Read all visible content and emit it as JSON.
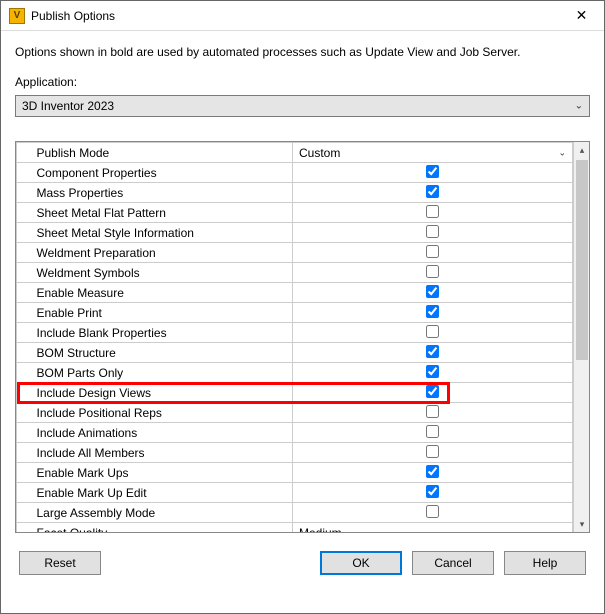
{
  "window": {
    "title": "Publish Options",
    "icon_letter": "V"
  },
  "description": "Options shown in bold are used by automated processes such as Update View and Job Server.",
  "application_label": "Application:",
  "application_value": "3D Inventor 2023",
  "rows": [
    {
      "label": "Publish Mode",
      "type": "dropdown",
      "value": "Custom"
    },
    {
      "label": "Component Properties",
      "type": "check",
      "checked": true
    },
    {
      "label": "Mass Properties",
      "type": "check",
      "checked": true
    },
    {
      "label": "Sheet Metal Flat Pattern",
      "type": "check",
      "checked": false
    },
    {
      "label": "Sheet Metal Style Information",
      "type": "check",
      "checked": false
    },
    {
      "label": "Weldment Preparation",
      "type": "check",
      "checked": false
    },
    {
      "label": "Weldment Symbols",
      "type": "check",
      "checked": false
    },
    {
      "label": "Enable Measure",
      "type": "check",
      "checked": true
    },
    {
      "label": "Enable Print",
      "type": "check",
      "checked": true
    },
    {
      "label": "Include Blank Properties",
      "type": "check",
      "checked": false
    },
    {
      "label": "BOM Structure",
      "type": "check",
      "checked": true
    },
    {
      "label": "BOM Parts Only",
      "type": "check",
      "checked": true
    },
    {
      "label": "Include Design Views",
      "type": "check",
      "checked": true,
      "highlight": true
    },
    {
      "label": "Include Positional Reps",
      "type": "check",
      "checked": false
    },
    {
      "label": "Include Animations",
      "type": "check",
      "checked": false
    },
    {
      "label": "Include All Members",
      "type": "check",
      "checked": false
    },
    {
      "label": "Enable Mark Ups",
      "type": "check",
      "checked": true
    },
    {
      "label": "Enable Mark Up Edit",
      "type": "check",
      "checked": true
    },
    {
      "label": "Large Assembly Mode",
      "type": "check",
      "checked": false
    },
    {
      "label": "Facet Quality",
      "type": "dropdown",
      "value": "Medium"
    }
  ],
  "buttons": {
    "reset": "Reset",
    "ok": "OK",
    "cancel": "Cancel",
    "help": "Help"
  }
}
